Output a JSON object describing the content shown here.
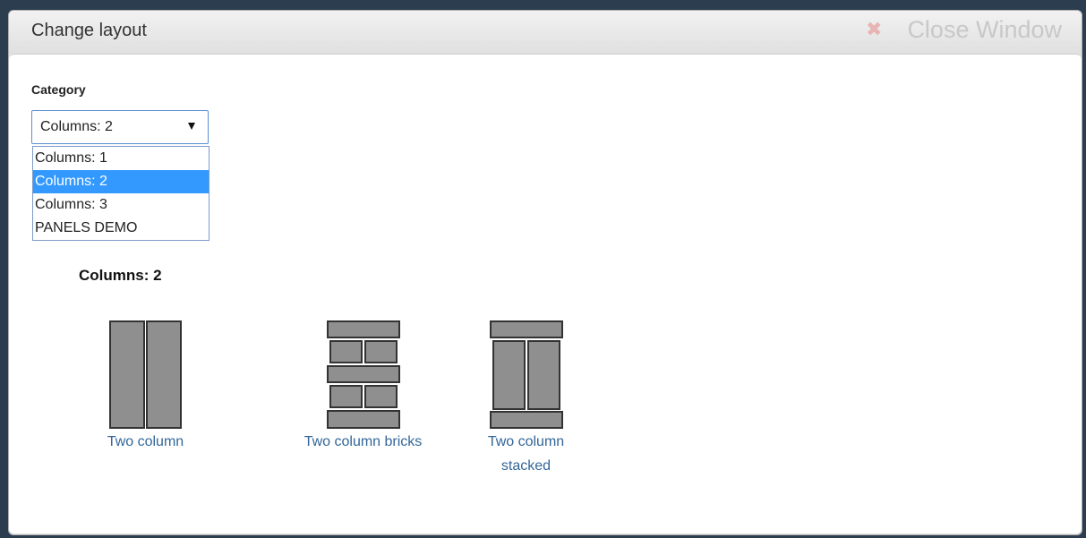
{
  "background": {
    "text": ""
  },
  "modal": {
    "title": "Change layout",
    "close_label": "Close Window",
    "close_icon": "close-x-icon"
  },
  "category": {
    "label": "Category",
    "selected": "Columns: 2",
    "options": [
      "Columns: 1",
      "Columns: 2",
      "Columns: 3",
      "PANELS DEMO"
    ]
  },
  "section": {
    "title": "Columns: 2"
  },
  "layouts": [
    {
      "label_line1": "Two column",
      "label_line2": ""
    },
    {
      "label_line1": "Two column bricks",
      "label_line2": ""
    },
    {
      "label_line1": "Two column",
      "label_line2": "stacked"
    }
  ],
  "colors": {
    "thumb_fill": "#8f8f8f",
    "thumb_stroke": "#333333",
    "link": "#336699",
    "selected_option": "#3399ff"
  }
}
